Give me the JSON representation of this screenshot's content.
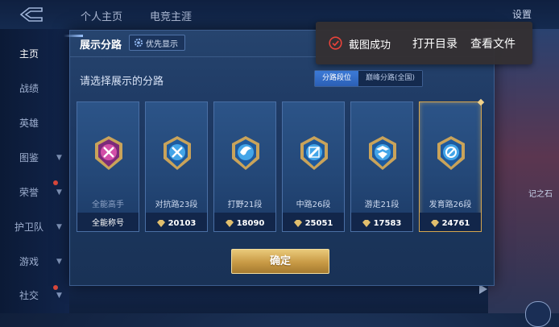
{
  "topbar": {
    "tabs": [
      "个人主页",
      "电竞主涯"
    ],
    "settings_label": "设置"
  },
  "sidebar": {
    "items": [
      {
        "label": "主页",
        "active": true
      },
      {
        "label": "战绩"
      },
      {
        "label": "英雄"
      },
      {
        "label": "图鉴"
      },
      {
        "label": "荣誉"
      },
      {
        "label": "护卫队"
      },
      {
        "label": "游戏"
      },
      {
        "label": "社交"
      }
    ]
  },
  "background": {
    "right_text": "记之石"
  },
  "dialog": {
    "title": "展示分路",
    "priority_chip": "优先显示",
    "prompt": "请选择展示的分路",
    "segments": [
      {
        "label": "分路段位",
        "active": true
      },
      {
        "label": "巅峰分路(全国)",
        "active": false
      }
    ],
    "cards": [
      {
        "name": "全能高手",
        "score": "全能称号",
        "icon": "all-round-badge",
        "selected": false
      },
      {
        "name": "对抗路23段",
        "score": "20103",
        "icon": "clash-lane-badge",
        "selected": false
      },
      {
        "name": "打野21段",
        "score": "18090",
        "icon": "jungle-badge",
        "selected": false
      },
      {
        "name": "中路26段",
        "score": "25051",
        "icon": "mid-lane-badge",
        "selected": false
      },
      {
        "name": "游走21段",
        "score": "17583",
        "icon": "roam-badge",
        "selected": false
      },
      {
        "name": "发育路26段",
        "score": "24761",
        "icon": "farm-lane-badge",
        "selected": true
      }
    ],
    "confirm_label": "确定"
  },
  "toast": {
    "message": "截图成功",
    "open_dir": "打开目录",
    "view_file": "查看文件"
  },
  "colors": {
    "accent_gold": "#d6a64e",
    "active_blue": "#3d7bd8",
    "toast_bg": "#343032",
    "success_red": "#e8433a"
  }
}
